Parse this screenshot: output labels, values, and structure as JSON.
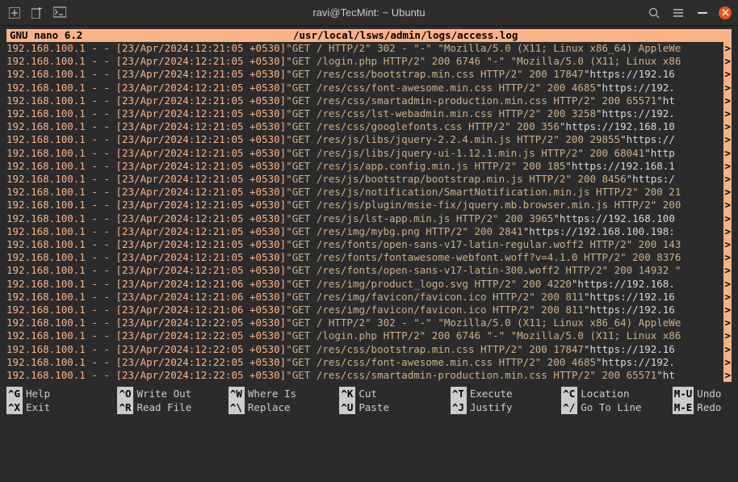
{
  "window": {
    "title": "ravi@TecMint: ~ Ubuntu"
  },
  "nano": {
    "app": "GNU nano 6.2",
    "file": "/usr/local/lsws/admin/logs/access.log"
  },
  "log_prefix": {
    "ip": "192.168.100.1",
    "dashes": " - - "
  },
  "lines": [
    {
      "ts": "[23/Apr/2024:12:21:05 +0530]",
      "q": "\"GET / HTTP/2\" 302 - \"-\" \"Mozilla/5.0 (X11; Linux x86_64) AppleWe",
      "url": "",
      "arrow": ">"
    },
    {
      "ts": "[23/Apr/2024:12:21:05 +0530]",
      "q": "\"GET /login.php HTTP/2\" 200 6746 \"-\" \"Mozilla/5.0 (X11; Linux x86",
      "url": "",
      "arrow": ">"
    },
    {
      "ts": "[23/Apr/2024:12:21:05 +0530]",
      "q": "\"GET /res/css/bootstrap.min.css HTTP/2\" 200 17847 ",
      "url": "\"https://192.16",
      "arrow": ">"
    },
    {
      "ts": "[23/Apr/2024:12:21:05 +0530]",
      "q": "\"GET /res/css/font-awesome.min.css HTTP/2\" 200 4685 ",
      "url": "\"https://192.",
      "arrow": ">"
    },
    {
      "ts": "[23/Apr/2024:12:21:05 +0530]",
      "q": "\"GET /res/css/smartadmin-production.min.css HTTP/2\" 200 65571 ",
      "url": "\"ht",
      "arrow": ">"
    },
    {
      "ts": "[23/Apr/2024:12:21:05 +0530]",
      "q": "\"GET /res/css/lst-webadmin.min.css HTTP/2\" 200 3258 ",
      "url": "\"https://192.",
      "arrow": ">"
    },
    {
      "ts": "[23/Apr/2024:12:21:05 +0530]",
      "q": "\"GET /res/css/googlefonts.css HTTP/2\" 200 356 ",
      "url": "\"https://192.168.10",
      "arrow": ">"
    },
    {
      "ts": "[23/Apr/2024:12:21:05 +0530]",
      "q": "\"GET /res/js/libs/jquery-2.2.4.min.js HTTP/2\" 200 29855 ",
      "url": "\"https://",
      "arrow": ">"
    },
    {
      "ts": "[23/Apr/2024:12:21:05 +0530]",
      "q": "\"GET /res/js/libs/jquery-ui-1.12.1.min.js HTTP/2\" 200 68041 ",
      "url": "\"http",
      "arrow": ">"
    },
    {
      "ts": "[23/Apr/2024:12:21:05 +0530]",
      "q": "\"GET /res/js/app.config.min.js HTTP/2\" 200 185 ",
      "url": "\"https://192.168.1",
      "arrow": ">"
    },
    {
      "ts": "[23/Apr/2024:12:21:05 +0530]",
      "q": "\"GET /res/js/bootstrap/bootstrap.min.js HTTP/2\" 200 8456 ",
      "url": "\"https:/",
      "arrow": ">"
    },
    {
      "ts": "[23/Apr/2024:12:21:05 +0530]",
      "q": "\"GET /res/js/notification/SmartNotification.min.js HTTP/2\" 200 21",
      "url": "",
      "arrow": ">"
    },
    {
      "ts": "[23/Apr/2024:12:21:05 +0530]",
      "q": "\"GET /res/js/plugin/msie-fix/jquery.mb.browser.min.js HTTP/2\" 200",
      "url": "",
      "arrow": ">"
    },
    {
      "ts": "[23/Apr/2024:12:21:05 +0530]",
      "q": "\"GET /res/js/lst-app.min.js HTTP/2\" 200 3965 ",
      "url": "\"https://192.168.100",
      "arrow": ">"
    },
    {
      "ts": "[23/Apr/2024:12:21:05 +0530]",
      "q": "\"GET /res/img/mybg.png HTTP/2\" 200 2841 ",
      "url": "\"https://192.168.100.198:",
      "arrow": ">"
    },
    {
      "ts": "[23/Apr/2024:12:21:05 +0530]",
      "q": "\"GET /res/fonts/open-sans-v17-latin-regular.woff2 HTTP/2\" 200 143",
      "url": "",
      "arrow": ">"
    },
    {
      "ts": "[23/Apr/2024:12:21:05 +0530]",
      "q": "\"GET /res/fonts/fontawesome-webfont.woff?v=4.1.0 HTTP/2\" 200 8376",
      "url": "",
      "arrow": ">"
    },
    {
      "ts": "[23/Apr/2024:12:21:05 +0530]",
      "q": "\"GET /res/fonts/open-sans-v17-latin-300.woff2 HTTP/2\" 200 14932 \"",
      "url": "",
      "arrow": ">"
    },
    {
      "ts": "[23/Apr/2024:12:21:06 +0530]",
      "q": "\"GET /res/img/product_logo.svg HTTP/2\" 200 4220 ",
      "url": "\"https://192.168.",
      "arrow": ">"
    },
    {
      "ts": "[23/Apr/2024:12:21:06 +0530]",
      "q": "\"GET /res/img/favicon/favicon.ico HTTP/2\" 200 811 ",
      "url": "\"https://192.16",
      "arrow": ">"
    },
    {
      "ts": "[23/Apr/2024:12:21:06 +0530]",
      "q": "\"GET /res/img/favicon/favicon.ico HTTP/2\" 200 811 ",
      "url": "\"https://192.16",
      "arrow": ">"
    },
    {
      "ts": "[23/Apr/2024:12:22:05 +0530]",
      "q": "\"GET / HTTP/2\" 302 - \"-\" \"Mozilla/5.0 (X11; Linux x86_64) AppleWe",
      "url": "",
      "arrow": ">"
    },
    {
      "ts": "[23/Apr/2024:12:22:05 +0530]",
      "q": "\"GET /login.php HTTP/2\" 200 6746 \"-\" \"Mozilla/5.0 (X11; Linux x86",
      "url": "",
      "arrow": ">"
    },
    {
      "ts": "[23/Apr/2024:12:22:05 +0530]",
      "q": "\"GET /res/css/bootstrap.min.css HTTP/2\" 200 17847 ",
      "url": "\"https://192.16",
      "arrow": ">"
    },
    {
      "ts": "[23/Apr/2024:12:22:05 +0530]",
      "q": "\"GET /res/css/font-awesome.min.css HTTP/2\" 200 4685 ",
      "url": "\"https://192.",
      "arrow": ">"
    },
    {
      "ts": "[23/Apr/2024:12:22:05 +0530]",
      "q": "\"GET /res/css/smartadmin-production.min.css HTTP/2\" 200 65571 ",
      "url": "\"ht",
      "arrow": ">"
    }
  ],
  "shortcuts": {
    "row1": [
      {
        "key": "^G",
        "label": "Help"
      },
      {
        "key": "^O",
        "label": "Write Out"
      },
      {
        "key": "^W",
        "label": "Where Is"
      },
      {
        "key": "^K",
        "label": "Cut"
      },
      {
        "key": "^T",
        "label": "Execute"
      },
      {
        "key": "^C",
        "label": "Location"
      },
      {
        "key": "M-U",
        "label": "Undo"
      }
    ],
    "row2": [
      {
        "key": "^X",
        "label": "Exit"
      },
      {
        "key": "^R",
        "label": "Read File"
      },
      {
        "key": "^\\",
        "label": "Replace"
      },
      {
        "key": "^U",
        "label": "Paste"
      },
      {
        "key": "^J",
        "label": "Justify"
      },
      {
        "key": "^/",
        "label": "Go To Line"
      },
      {
        "key": "M-E",
        "label": "Redo"
      }
    ]
  }
}
